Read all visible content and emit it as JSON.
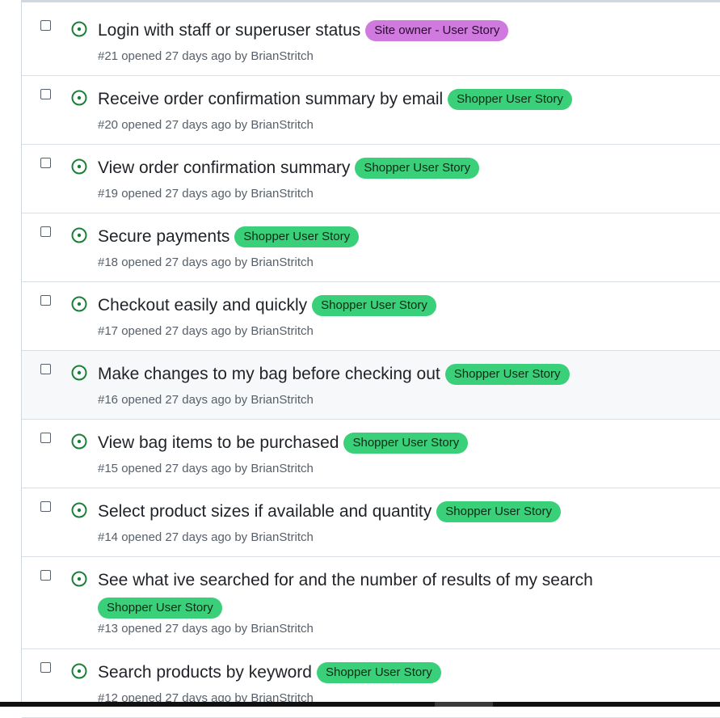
{
  "colors": {
    "open_icon": "#1a7f37",
    "shopper_label": "#3ad07a",
    "owner_label": "#d07ae0",
    "meta_text": "#57606a",
    "hover_row": "#f6f8fa"
  },
  "issues": [
    {
      "title": "Login with staff or superuser status",
      "label": "Site owner - User Story",
      "meta": "#21 opened 27 days ago by BrianStritch"
    },
    {
      "title": "Receive order confirmation summary by email",
      "label": "Shopper User Story",
      "meta": "#20 opened 27 days ago by BrianStritch"
    },
    {
      "title": "View order confirmation summary",
      "label": "Shopper User Story",
      "meta": "#19 opened 27 days ago by BrianStritch"
    },
    {
      "title": "Secure payments",
      "label": "Shopper User Story",
      "meta": "#18 opened 27 days ago by BrianStritch"
    },
    {
      "title": "Checkout easily and quickly",
      "label": "Shopper User Story",
      "meta": "#17 opened 27 days ago by BrianStritch"
    },
    {
      "title": "Make changes to my bag before checking out",
      "label": "Shopper User Story",
      "meta": "#16 opened 27 days ago by BrianStritch"
    },
    {
      "title": "View bag items to be purchased",
      "label": "Shopper User Story",
      "meta": "#15 opened 27 days ago by BrianStritch"
    },
    {
      "title": "Select product sizes if available and quantity",
      "label": "Shopper User Story",
      "meta": "#14 opened 27 days ago by BrianStritch"
    },
    {
      "title": "See what ive searched for and the number of results of my search",
      "label": "Shopper User Story",
      "meta": "#13 opened 27 days ago by BrianStritch"
    },
    {
      "title": "Search products by keyword",
      "label": "Shopper User Story",
      "meta": "#12 opened 27 days ago by BrianStritch"
    }
  ]
}
